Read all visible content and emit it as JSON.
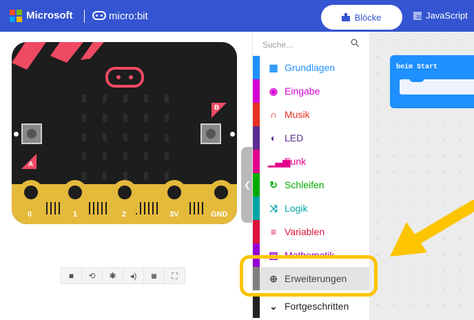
{
  "header": {
    "brand": "Microsoft",
    "product": "micro:bit",
    "tabs": [
      {
        "label": "Blöcke",
        "icon": "blocks-icon",
        "active": true
      },
      {
        "label": "JavaScript",
        "icon": "js-icon",
        "active": false
      }
    ],
    "bar_color": "#3454d1"
  },
  "simulator": {
    "button_a": "A",
    "button_b": "B",
    "pins": [
      "0",
      "1",
      "2",
      "3V",
      "GND"
    ],
    "controls": [
      {
        "name": "stop-icon",
        "glyph": "■"
      },
      {
        "name": "restart-icon",
        "glyph": "⟲"
      },
      {
        "name": "debug-icon",
        "glyph": "✱"
      },
      {
        "name": "sound-icon",
        "glyph": "◂)"
      },
      {
        "name": "screenshot-icon",
        "glyph": "◙"
      },
      {
        "name": "fullscreen-icon",
        "glyph": "⛶"
      }
    ]
  },
  "toolbox": {
    "search_placeholder": "Suche...",
    "categories": [
      {
        "label": "Grundlagen",
        "color": "#1e90ff",
        "icon": "grid-icon"
      },
      {
        "label": "Eingabe",
        "color": "#d400d4",
        "icon": "circle-icon"
      },
      {
        "label": "Musik",
        "color": "#e63022",
        "icon": "headphones-icon"
      },
      {
        "label": "LED",
        "color": "#5c2d91",
        "icon": "toggle-icon"
      },
      {
        "label": "Funk",
        "color": "#e3008c",
        "icon": "signal-icon"
      },
      {
        "label": "Schleifen",
        "color": "#00aa00",
        "icon": "loop-icon"
      },
      {
        "label": "Logik",
        "color": "#00a4a6",
        "icon": "shuffle-icon"
      },
      {
        "label": "Variablen",
        "color": "#dc143c",
        "icon": "list-icon"
      },
      {
        "label": "Mathematik",
        "color": "#9400d3",
        "icon": "calculator-icon"
      },
      {
        "label": "Erweiterungen",
        "color": "#808080",
        "icon": "plus-circle-icon"
      },
      {
        "label": "Fortgeschritten",
        "color": "#222222",
        "icon": "chevron-down-icon"
      }
    ]
  },
  "workspace": {
    "block_label": "beim Start",
    "block_color": "#1e90ff"
  },
  "annotation": {
    "highlight_color": "#fdc400"
  }
}
